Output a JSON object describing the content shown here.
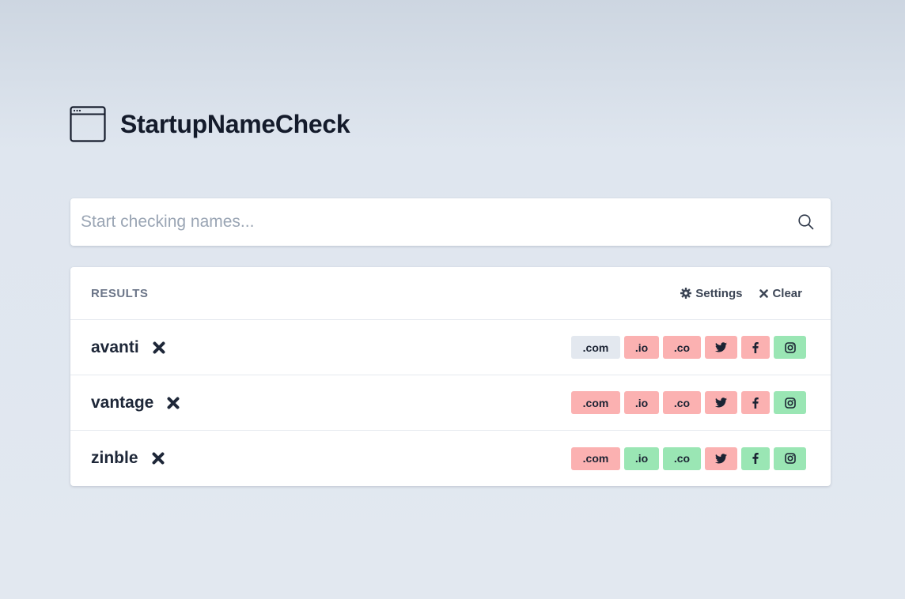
{
  "app": {
    "title": "StartupNameCheck",
    "logo_icon": "browser-window-icon"
  },
  "search": {
    "placeholder": "Start checking names...",
    "value": "",
    "icon": "search-icon"
  },
  "results": {
    "title": "RESULTS",
    "settings_label": "Settings",
    "clear_label": "Clear",
    "rows": [
      {
        "name": "avanti",
        "badges": [
          {
            "label": ".com",
            "status": "unknown"
          },
          {
            "label": ".io",
            "status": "taken"
          },
          {
            "label": ".co",
            "status": "taken"
          },
          {
            "label": "twitter-icon",
            "status": "taken"
          },
          {
            "label": "facebook-icon",
            "status": "taken"
          },
          {
            "label": "instagram-icon",
            "status": "available"
          }
        ]
      },
      {
        "name": "vantage",
        "badges": [
          {
            "label": ".com",
            "status": "taken"
          },
          {
            "label": ".io",
            "status": "taken"
          },
          {
            "label": ".co",
            "status": "taken"
          },
          {
            "label": "twitter-icon",
            "status": "taken"
          },
          {
            "label": "facebook-icon",
            "status": "taken"
          },
          {
            "label": "instagram-icon",
            "status": "available"
          }
        ]
      },
      {
        "name": "zinble",
        "badges": [
          {
            "label": ".com",
            "status": "taken"
          },
          {
            "label": ".io",
            "status": "available"
          },
          {
            "label": ".co",
            "status": "available"
          },
          {
            "label": "twitter-icon",
            "status": "taken"
          },
          {
            "label": "facebook-icon",
            "status": "available"
          },
          {
            "label": "instagram-icon",
            "status": "available"
          }
        ]
      }
    ]
  },
  "colors": {
    "taken": "#fbb1b1",
    "available": "#9ae6b4",
    "unknown": "#e3e8ef",
    "text_dark": "#1e2738"
  }
}
